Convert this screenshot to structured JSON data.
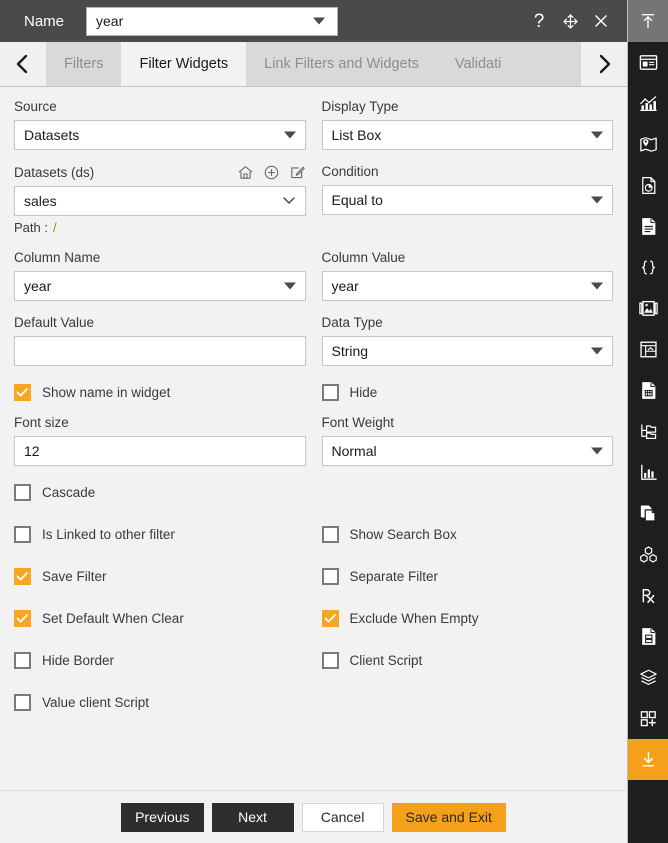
{
  "titlebar": {
    "name_label": "Name",
    "name_value": "year",
    "help_icon": "question-mark-icon",
    "move_icon": "move-four-arrows-icon",
    "close_icon": "close-x-icon"
  },
  "tabstrip": {
    "prev_icon": "chevron-left-icon",
    "next_icon": "chevron-right-icon",
    "tabs": [
      {
        "label": "Filters",
        "active": false
      },
      {
        "label": "Filter Widgets",
        "active": true
      },
      {
        "label": "Link Filters and Widgets",
        "active": false
      },
      {
        "label": "Validati",
        "active": false
      }
    ]
  },
  "form": {
    "source": {
      "label": "Source",
      "value": "Datasets"
    },
    "display_type": {
      "label": "Display Type",
      "value": "List Box"
    },
    "datasets": {
      "label": "Datasets (ds)",
      "value": "sales",
      "home_icon": "home-icon",
      "add_icon": "plus-circle-icon",
      "edit_icon": "edit-pencil-icon",
      "path_label": "Path :",
      "path_value": "/"
    },
    "condition": {
      "label": "Condition",
      "value": "Equal to"
    },
    "column_name": {
      "label": "Column Name",
      "value": "year"
    },
    "column_value": {
      "label": "Column Value",
      "value": "year"
    },
    "default_value": {
      "label": "Default Value",
      "value": "",
      "placeholder": ""
    },
    "data_type": {
      "label": "Data Type",
      "value": "String"
    },
    "font_size": {
      "label": "Font size",
      "value": "12"
    },
    "font_weight": {
      "label": "Font Weight",
      "value": "Normal"
    }
  },
  "checkboxes": [
    {
      "label": "Show name in widget",
      "checked": true,
      "col": "left"
    },
    {
      "label": "Hide",
      "checked": false,
      "col": "right"
    },
    {
      "label": "Cascade",
      "checked": false,
      "col": "left"
    },
    {
      "label": "Is Linked to other filter",
      "checked": false,
      "col": "left"
    },
    {
      "label": "Show Search Box",
      "checked": false,
      "col": "right"
    },
    {
      "label": "Save Filter",
      "checked": true,
      "col": "left"
    },
    {
      "label": "Separate Filter",
      "checked": false,
      "col": "right"
    },
    {
      "label": "Set Default When Clear",
      "checked": true,
      "col": "left"
    },
    {
      "label": "Exclude When Empty",
      "checked": true,
      "col": "right"
    },
    {
      "label": "Hide Border",
      "checked": false,
      "col": "left"
    },
    {
      "label": "Client Script",
      "checked": false,
      "col": "right"
    },
    {
      "label": "Value client Script",
      "checked": false,
      "col": "left"
    }
  ],
  "footer": {
    "previous": "Previous",
    "next": "Next",
    "cancel": "Cancel",
    "save_and_exit": "Save and Exit"
  },
  "rail": {
    "items": [
      {
        "icon": "collapse-up-arrow-icon",
        "state": "top"
      },
      {
        "icon": "dashboard-panel-icon",
        "state": "normal"
      },
      {
        "icon": "bar-chart-icon",
        "state": "normal"
      },
      {
        "icon": "map-pin-icon",
        "state": "normal"
      },
      {
        "icon": "pie-report-icon",
        "state": "normal"
      },
      {
        "icon": "document-icon",
        "state": "normal"
      },
      {
        "icon": "curly-braces-icon",
        "state": "normal"
      },
      {
        "icon": "image-gallery-icon",
        "state": "normal"
      },
      {
        "icon": "table-grid-icon",
        "state": "normal"
      },
      {
        "icon": "form-document-icon",
        "state": "normal"
      },
      {
        "icon": "folder-tree-icon",
        "state": "normal"
      },
      {
        "icon": "chart-axis-icon",
        "state": "normal"
      },
      {
        "icon": "copy-pages-icon",
        "state": "normal"
      },
      {
        "icon": "cubes-stack-icon",
        "state": "normal"
      },
      {
        "icon": "prescription-rx-icon",
        "state": "normal"
      },
      {
        "icon": "saved-document-icon",
        "state": "normal"
      },
      {
        "icon": "layers-icon",
        "state": "normal"
      },
      {
        "icon": "add-widget-grid-icon",
        "state": "normal"
      },
      {
        "icon": "download-arrow-icon",
        "state": "selected"
      }
    ]
  },
  "colors": {
    "accent": "#f5a01b",
    "checkbox_on": "#f5a623",
    "titlebar": "#4a4a4a",
    "tabstrip": "#d9d9d9",
    "body": "#f2f2f2",
    "rail": "#1e1e1e"
  }
}
